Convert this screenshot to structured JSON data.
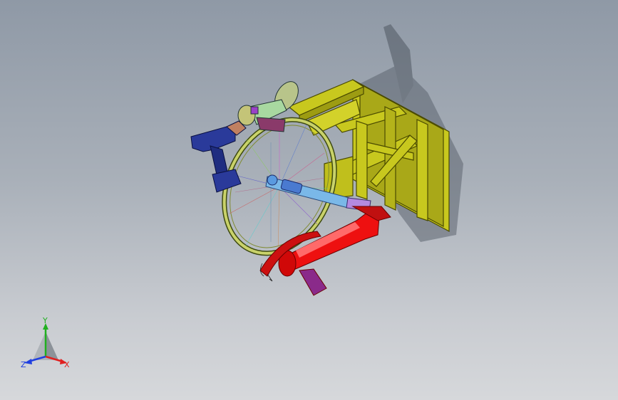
{
  "viewport": {
    "background_top": "#8f99a6",
    "background_bottom": "#d6d8db"
  },
  "triad": {
    "x_label": "X",
    "y_label": "Y",
    "z_label": "Z",
    "x_color": "#e02020",
    "y_color": "#20b020",
    "z_color": "#2040e0"
  },
  "colors": {
    "frame": "#c8c81e",
    "frame_edge": "#4a4a00",
    "wheel": "#c9d26a",
    "drill": "#2a3a9a",
    "actuator": "#ee1010",
    "clamp": "#8a2a8a",
    "shaft": "#7ab8e8"
  }
}
